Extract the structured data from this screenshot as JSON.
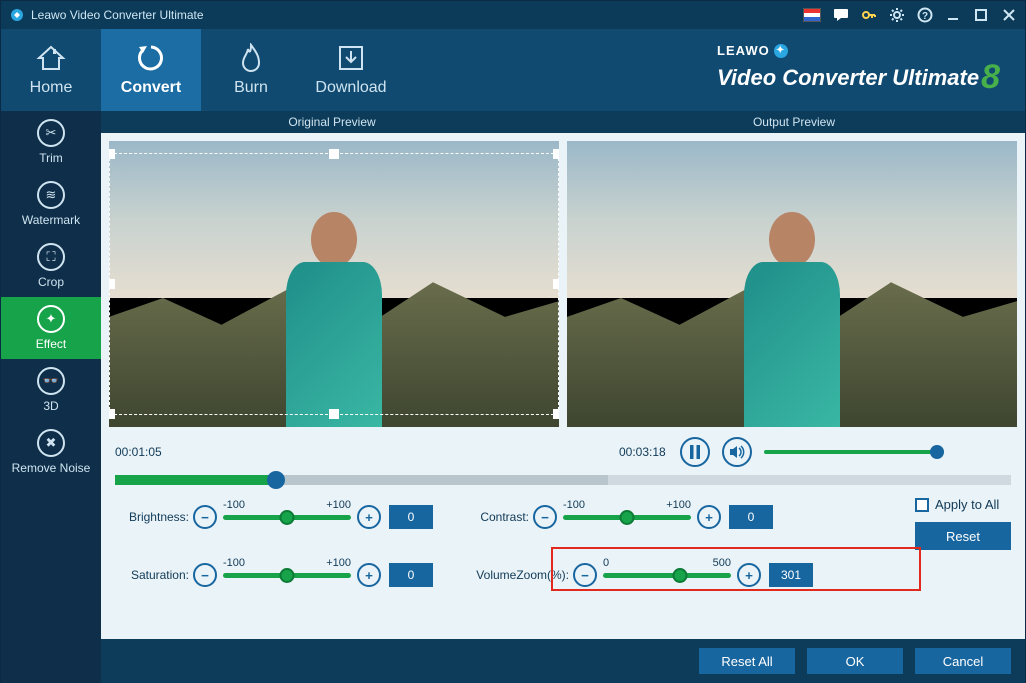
{
  "titlebar": {
    "title": "Leawo Video Converter Ultimate"
  },
  "main_nav": {
    "home": "Home",
    "convert": "Convert",
    "burn": "Burn",
    "download": "Download"
  },
  "logo": {
    "brand": "LEAWO",
    "product": "Video Converter Ultimate",
    "version_glyph": "8"
  },
  "side_nav": {
    "trim": "Trim",
    "watermark": "Watermark",
    "crop": "Crop",
    "effect": "Effect",
    "three_d": "3D",
    "remove_noise": "Remove Noise"
  },
  "preview": {
    "original": "Original Preview",
    "output": "Output Preview"
  },
  "playback": {
    "current_time": "00:01:05",
    "total_time": "00:03:18"
  },
  "effects": {
    "brightness": {
      "label": "Brightness:",
      "min": "-100",
      "max": "+100",
      "value": "0",
      "thumb_pct": 50
    },
    "saturation": {
      "label": "Saturation:",
      "min": "-100",
      "max": "+100",
      "value": "0",
      "thumb_pct": 50
    },
    "contrast": {
      "label": "Contrast:",
      "min": "-100",
      "max": "+100",
      "value": "0",
      "thumb_pct": 50
    },
    "volume": {
      "label": "VolumeZoom(%):",
      "min": "0",
      "max": "500",
      "value": "301",
      "thumb_pct": 60
    }
  },
  "options": {
    "apply_all": "Apply to All",
    "reset": "Reset"
  },
  "buttons": {
    "reset_all": "Reset All",
    "ok": "OK",
    "cancel": "Cancel"
  }
}
